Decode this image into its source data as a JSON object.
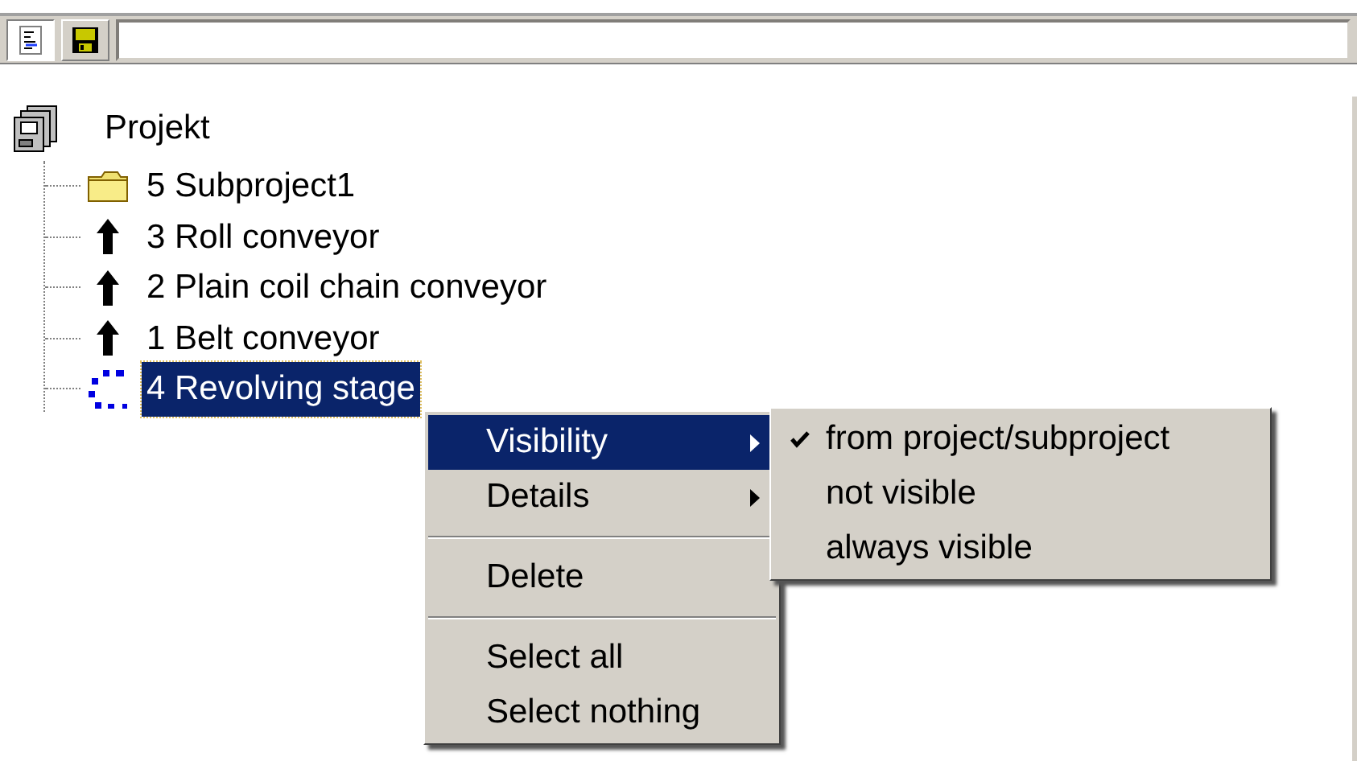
{
  "toolbar": {
    "buttons": [
      {
        "kind": "outline",
        "selected": true
      },
      {
        "kind": "save",
        "selected": false
      }
    ]
  },
  "tree": {
    "label": "Projekt",
    "kind": "project",
    "selected": false,
    "children": [
      {
        "label": "5 Subproject1",
        "kind": "folder",
        "selected": false
      },
      {
        "label": "3 Roll conveyor",
        "kind": "arrow",
        "selected": false
      },
      {
        "label": "2 Plain coil chain conveyor",
        "kind": "arrow",
        "selected": false
      },
      {
        "label": "1 Belt conveyor",
        "kind": "arrow",
        "selected": false
      },
      {
        "label": "4 Revolving stage",
        "kind": "dots",
        "selected": true
      }
    ]
  },
  "context_menu": {
    "items": [
      {
        "kind": "item",
        "label": "Visibility",
        "submenu": true,
        "selected": true
      },
      {
        "kind": "item",
        "label": "Details",
        "submenu": true,
        "selected": false
      },
      {
        "kind": "separator"
      },
      {
        "kind": "item",
        "label": "Delete",
        "submenu": false,
        "selected": false
      },
      {
        "kind": "separator"
      },
      {
        "kind": "item",
        "label": "Select all",
        "submenu": false,
        "selected": false
      },
      {
        "kind": "item",
        "label": "Select nothing",
        "submenu": false,
        "selected": false
      }
    ]
  },
  "submenu": {
    "items": [
      {
        "label": "from project/subproject",
        "checked": true
      },
      {
        "label": "not visible",
        "checked": false
      },
      {
        "label": "always visible",
        "checked": false
      }
    ]
  }
}
